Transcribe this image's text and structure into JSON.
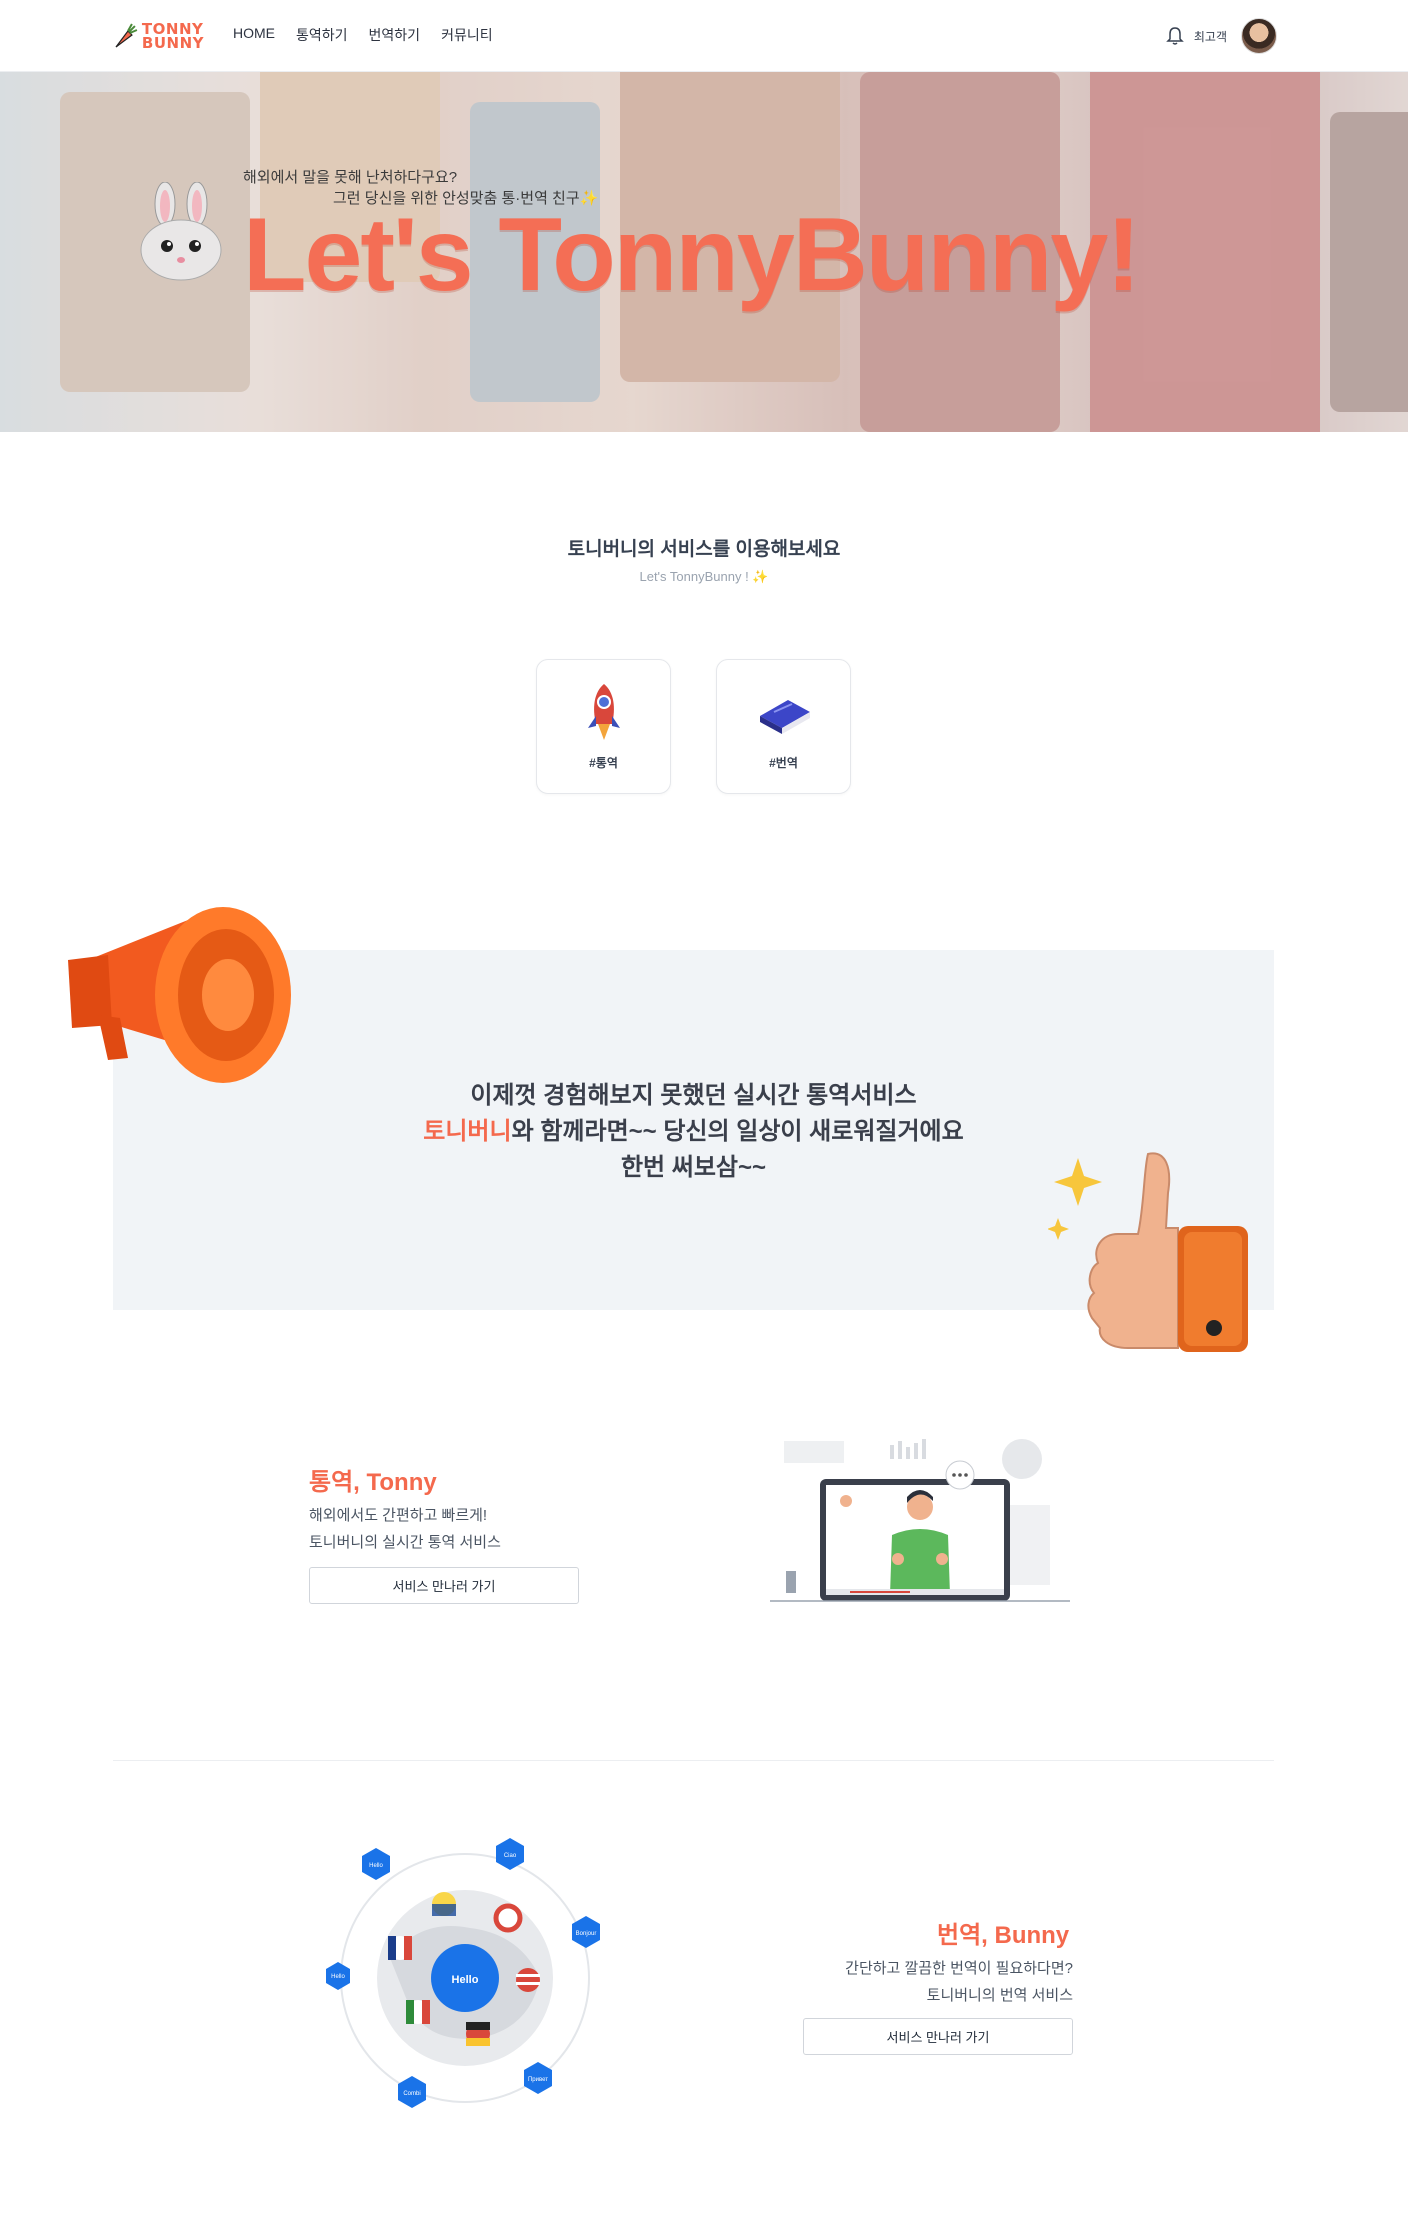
{
  "nav": {
    "logo_line1": "TONNY",
    "logo_line2": "BUNNY",
    "menu": [
      "HOME",
      "통역하기",
      "번역하기",
      "커뮤니티"
    ],
    "user_name": "최고객",
    "icons": {
      "bell": "bell-icon",
      "avatar": "avatar"
    }
  },
  "hero": {
    "line1": "해외에서 말을 못해 난처하다구요?",
    "line2": "그런 당신을 위한 안성맞춤 통·번역 친구✨",
    "title": "Let's TonnyBunny!"
  },
  "services": {
    "title": "토니버니의 서비스를 이용해보세요",
    "subtitle": "Let's TonnyBunny ! ✨",
    "cards": [
      {
        "label": "#통역",
        "icon": "rocket-icon"
      },
      {
        "label": "#번역",
        "icon": "book-icon"
      }
    ]
  },
  "promo": {
    "line1": "이제껏 경험해보지 못했던 실시간 통역서비스",
    "line2_highlight": "토니버니",
    "line2_rest": "와 함께라면~~ 당신의 일상이 새로워질거에요",
    "line3": "한번 써보삼~~"
  },
  "feature_interpret": {
    "title": "통역, Tonny",
    "desc1": "해외에서도 간편하고 빠르게!",
    "desc2": "토니버니의 실시간 통역 서비스",
    "button": "서비스 만나러 가기"
  },
  "feature_translate": {
    "title": "번역, Bunny",
    "desc1": "간단하고 깔끔한 번역이 필요하다면?",
    "desc2": "토니버니의 번역 서비스",
    "button": "서비스 만나러 가기",
    "globe_center": "Hello",
    "globe_words": [
      "Hello",
      "Ciao",
      "Bonjour",
      "Hello",
      "Привет",
      "Combi"
    ]
  },
  "colors": {
    "accent": "#f4694d",
    "promo_bg": "#f1f4f7",
    "text": "#374151",
    "hex_blue": "#1a73e8"
  }
}
